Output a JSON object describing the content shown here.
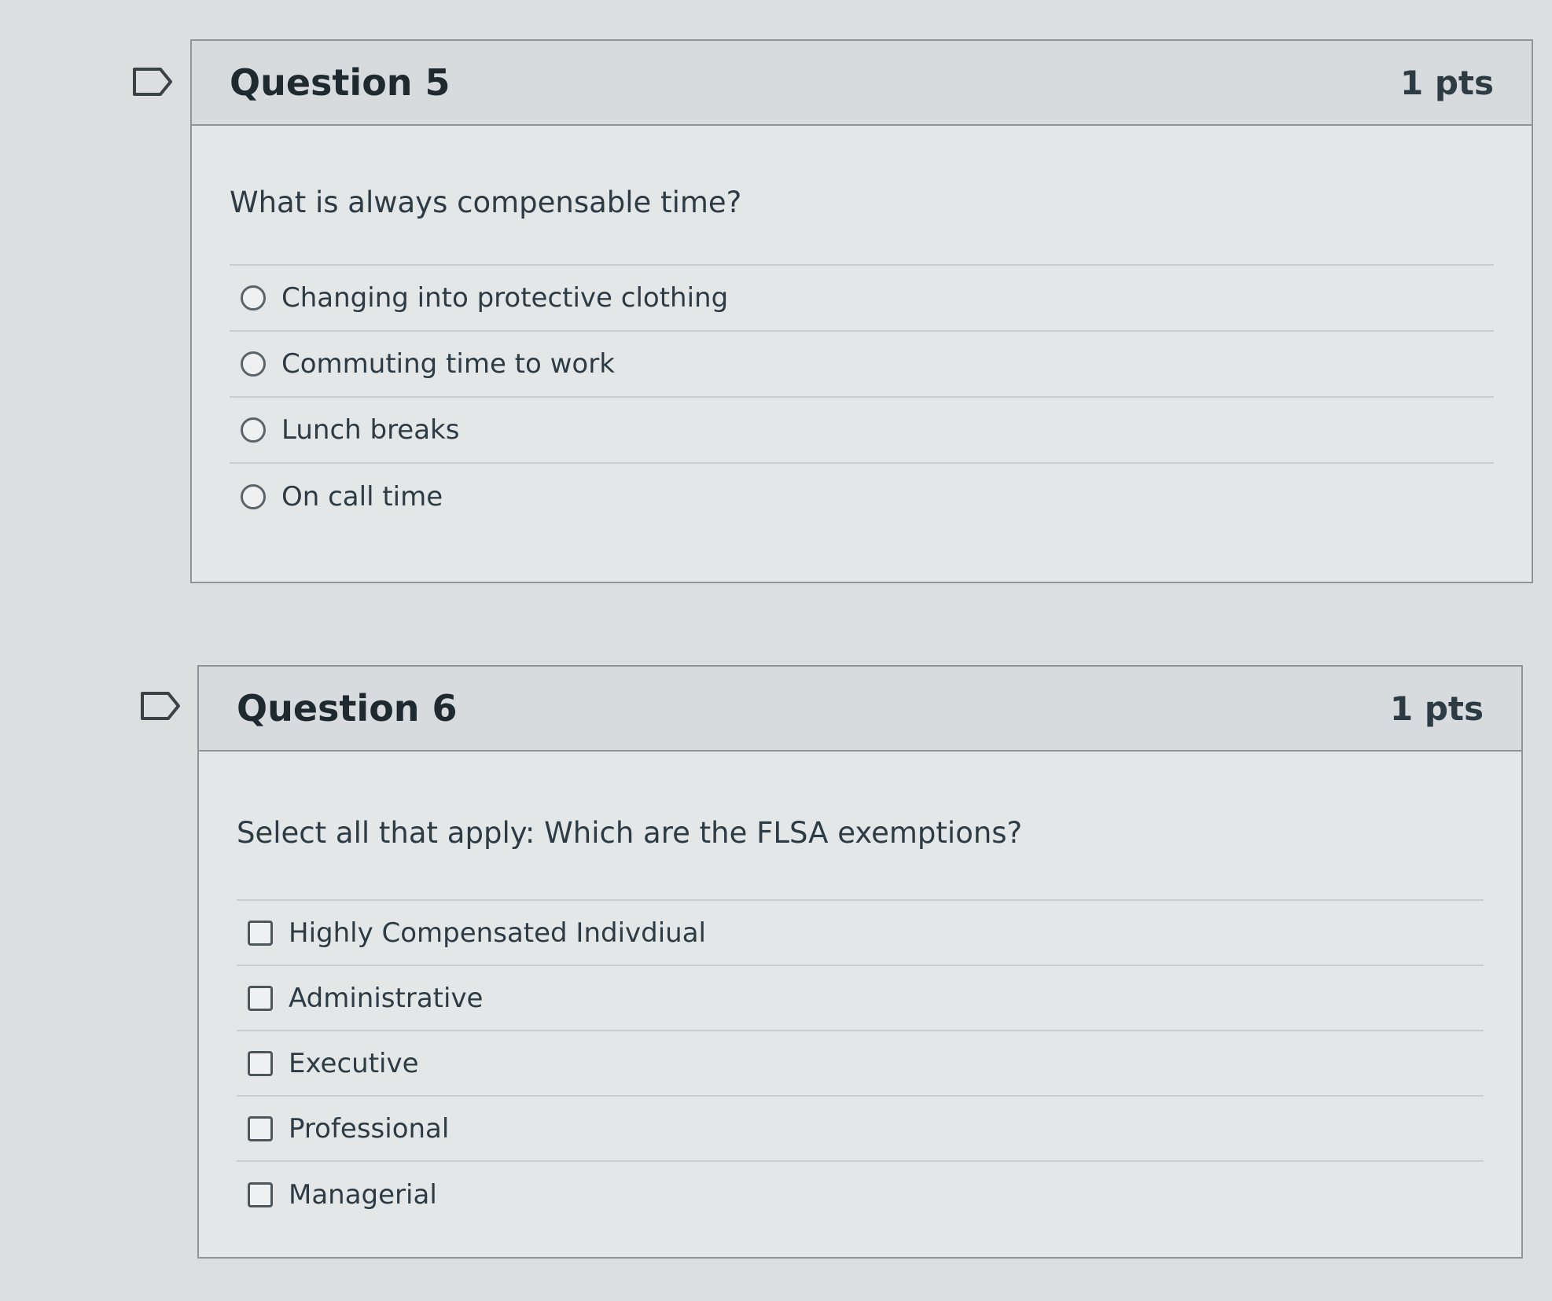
{
  "question5": {
    "title": "Question 5",
    "points": "1 pts",
    "text": "What is always compensable time?",
    "answers": [
      {
        "label": "Changing into protective clothing"
      },
      {
        "label": "Commuting time to work"
      },
      {
        "label": "Lunch breaks"
      },
      {
        "label": "On call time"
      }
    ]
  },
  "question6": {
    "title": "Question 6",
    "points": "1 pts",
    "text": "Select all that apply: Which are the FLSA exemptions?",
    "answers": [
      {
        "label": "Highly Compensated Indivdiual"
      },
      {
        "label": "Administrative"
      },
      {
        "label": "Executive"
      },
      {
        "label": "Professional"
      },
      {
        "label": "Managerial"
      }
    ]
  },
  "icons": {
    "flag": "flag-icon",
    "radio": "radio-button",
    "checkbox": "checkbox"
  }
}
